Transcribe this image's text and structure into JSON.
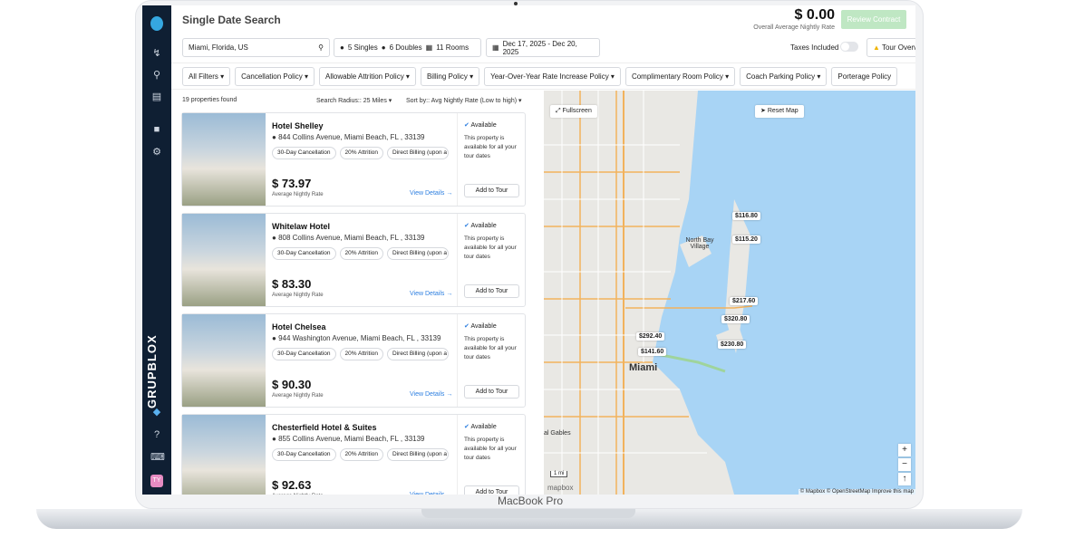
{
  "window": {
    "device_label": "MacBook Pro"
  },
  "sidebar": {
    "brand": "GRUPBLOX",
    "avatar": "TY",
    "icons": [
      "logo-icon",
      "route-icon",
      "search-icon",
      "chart-icon",
      "clipboard-icon",
      "gear-icon",
      "tag-icon",
      "help-icon",
      "keyboard-icon"
    ]
  },
  "header": {
    "title": "Single Date Search",
    "amount": "$ 0.00",
    "amount_sub": "Overall Average Nightly Rate",
    "review_label": "Review Contract"
  },
  "search": {
    "location": "Miami, Florida, US",
    "singles": "5 Singles",
    "doubles": "6 Doubles",
    "rooms": "11 Rooms",
    "dates": "Dec 17, 2025 - Dec 20, 2025",
    "taxes_label": "Taxes Included",
    "taxes_on": false,
    "tour_label": "Tour Overview"
  },
  "filters": [
    "All Filters",
    "Cancellation Policy",
    "Allowable Attrition Policy",
    "Billing Policy",
    "Year-Over-Year Rate Increase Policy",
    "Complimentary Room Policy",
    "Coach Parking Policy",
    "Porterage Policy"
  ],
  "list": {
    "count": "19 properties found",
    "radius": "Search Radius:: 25 Miles",
    "sort": "Sort by:: Avg Nightly Rate (Low to high)"
  },
  "hotels": [
    {
      "name": "Hotel Shelley",
      "address": "844 Collins Avenue, Miami Beach, FL , 33139",
      "tags": [
        "30-Day Cancellation",
        "20% Attrition",
        "Direct Billing (upon a"
      ],
      "price": "$ 73.97",
      "price_sub": "Average Nightly Rate",
      "details": "View Details →",
      "available": "Available",
      "available_text": "This property is available for all your tour dates",
      "add": "Add to Tour"
    },
    {
      "name": "Whitelaw Hotel",
      "address": "808 Collins Avenue, Miami Beach, FL , 33139",
      "tags": [
        "30-Day Cancellation",
        "20% Attrition",
        "Direct Billing (upon a"
      ],
      "price": "$ 83.30",
      "price_sub": "Average Nightly Rate",
      "details": "View Details →",
      "available": "Available",
      "available_text": "This property is available for all your tour dates",
      "add": "Add to Tour"
    },
    {
      "name": "Hotel Chelsea",
      "address": "944 Washington Avenue, Miami Beach, FL , 33139",
      "tags": [
        "30-Day Cancellation",
        "20% Attrition",
        "Direct Billing (upon a"
      ],
      "price": "$ 90.30",
      "price_sub": "Average Nightly Rate",
      "details": "View Details →",
      "available": "Available",
      "available_text": "This property is available for all your tour dates",
      "add": "Add to Tour"
    },
    {
      "name": "Chesterfield Hotel & Suites",
      "address": "855 Collins Avenue, Miami Beach, FL , 33139",
      "tags": [
        "30-Day Cancellation",
        "20% Attrition",
        "Direct Billing (upon a"
      ],
      "price": "$ 92.63",
      "price_sub": "Average Nightly Rate",
      "details": "View Details →",
      "available": "Available",
      "available_text": "This property is available for all your tour dates",
      "add": "Add to Tour"
    }
  ],
  "map": {
    "fullscreen": "Fullscreen",
    "reset": "Reset Map",
    "pins": [
      "$116.80",
      "$115.20",
      "$217.60",
      "$320.80",
      "$292.40",
      "$141.60",
      "$230.80"
    ],
    "labels": {
      "north_bay": "North Bay Village",
      "miami": "Miami",
      "gables": "al Gables",
      "i195": "195",
      "i95": "195",
      "r1": "915"
    },
    "scale": "1 mi",
    "logo": "mapbox",
    "attribution": "© Mapbox © OpenStreetMap Improve this map"
  }
}
